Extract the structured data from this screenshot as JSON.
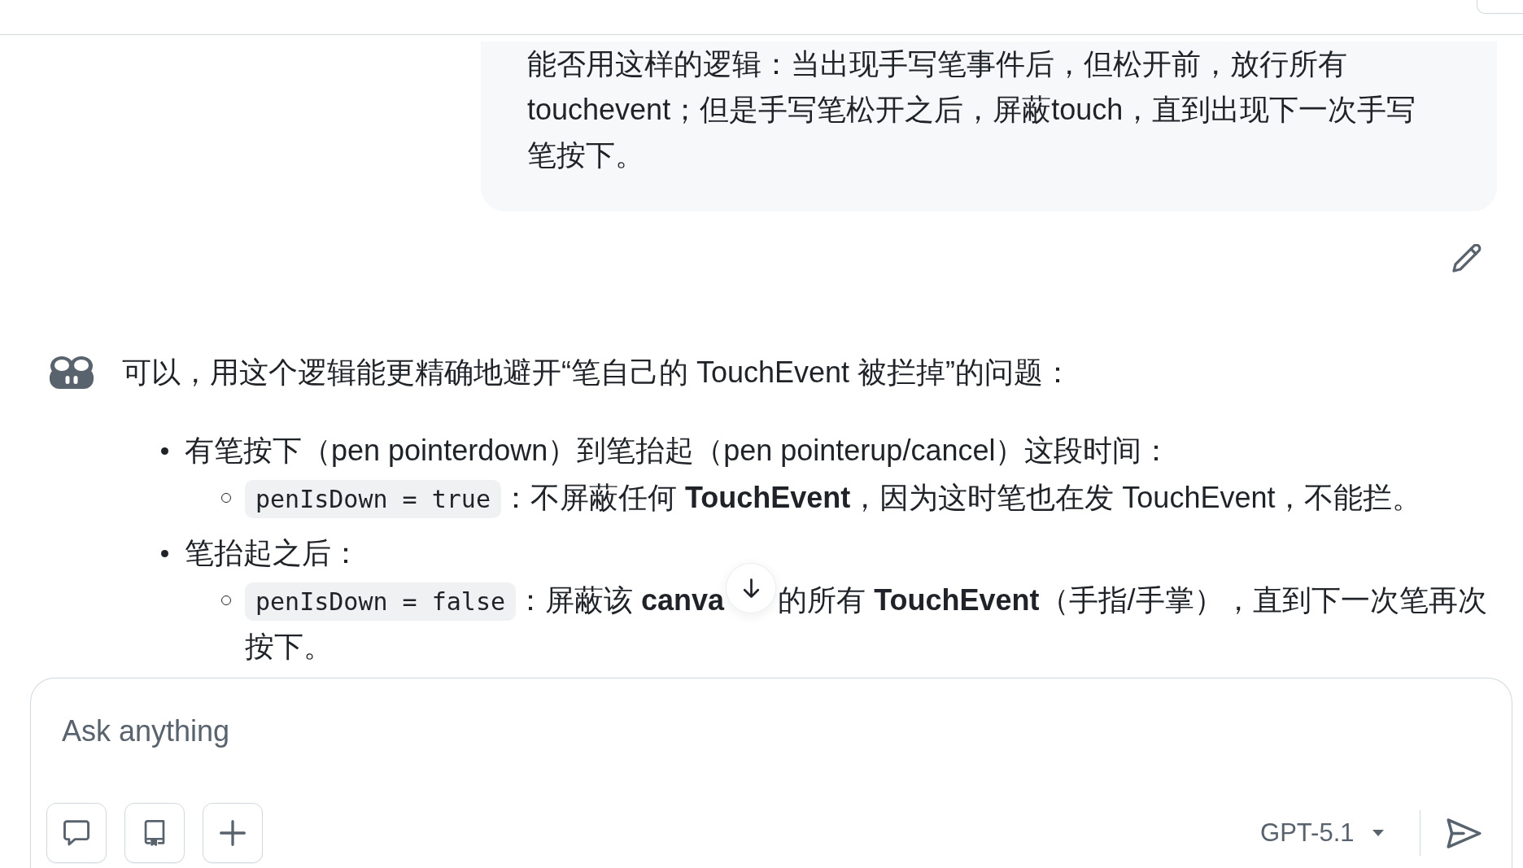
{
  "conversation": {
    "user_message": {
      "text": "能否用这样的逻辑：当出现手写笔事件后，但松开前，放行所有touchevent；但是手写笔松开之后，屏蔽touch，直到出现下一次手写笔按下。"
    },
    "assistant_message": {
      "intro": "可以，用这个逻辑能更精确地避开“笔自己的 TouchEvent 被拦掉”的问题：",
      "bullets": [
        {
          "text": "有笔按下（pen pointerdown）到笔抬起（pen pointerup/cancel）这段时间：",
          "children": [
            {
              "code": "penIsDown = true",
              "text": "：不屏蔽任何 **TouchEvent**，因为这时笔也在发 TouchEvent，不能拦。"
            }
          ]
        },
        {
          "text": "笔抬起之后：",
          "children": [
            {
              "code": "penIsDown = false",
              "text": "：屏蔽该 **canva**",
              "text_after_overlay": "的所有 **TouchEvent**（手指/手掌），直到下一次笔再次",
              "text_next_line": "按下。"
            }
          ]
        }
      ]
    }
  },
  "composer": {
    "placeholder": "Ask anything",
    "model": "GPT-5.1"
  }
}
